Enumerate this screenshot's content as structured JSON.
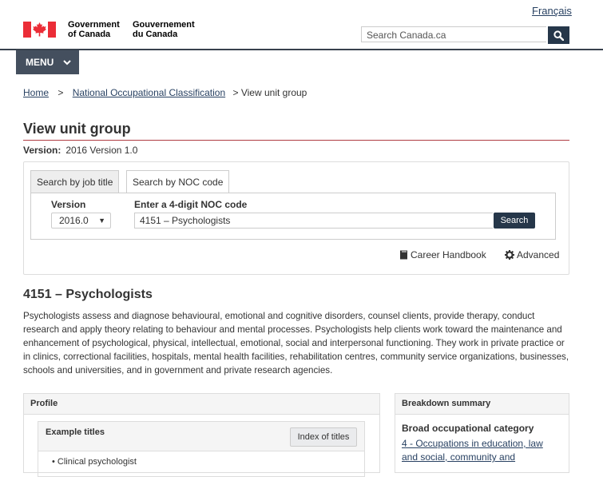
{
  "header": {
    "language_link": "Français",
    "signature_en_line1": "Government",
    "signature_en_line2": "of Canada",
    "signature_fr_line1": "Gouvernement",
    "signature_fr_line2": "du Canada",
    "search_placeholder": "Search Canada.ca",
    "menu_label": "MENU"
  },
  "breadcrumb": {
    "home": "Home",
    "separator": ">",
    "noc": "National Occupational Classification",
    "current": "> View unit group"
  },
  "page": {
    "title": "View unit group",
    "version_label": "Version:",
    "version_value": "2016 Version 1.0"
  },
  "search_panel": {
    "tabs": [
      "Search by job title",
      "Search by NOC code"
    ],
    "active_tab": 1,
    "version_label": "Version",
    "version_value": "2016.0",
    "noc_label": "Enter a 4-digit NOC code",
    "noc_value": "4151 – Psychologists",
    "search_button": "Search",
    "career_handbook": "Career Handbook",
    "advanced": "Advanced"
  },
  "unit_group": {
    "heading": "4151 – Psychologists",
    "description": "Psychologists assess and diagnose behavioural, emotional and cognitive disorders, counsel clients, provide therapy, conduct research and apply theory relating to behaviour and mental processes. Psychologists help clients work toward the maintenance and enhancement of psychological, physical, intellectual, emotional, social and interpersonal functioning. They work in private practice or in clinics, correctional facilities, hospitals, mental health facilities, rehabilitation centres, community service organizations, businesses, schools and universities, and in government and private research agencies."
  },
  "profile": {
    "heading": "Profile",
    "example_titles_heading": "Example titles",
    "index_button": "Index of titles",
    "example_titles": [
      "Clinical psychologist"
    ]
  },
  "breakdown": {
    "heading": "Breakdown summary",
    "broad_category_label": "Broad occupational category",
    "broad_category_link": "4 - Occupations in education, law and social, community and"
  },
  "colors": {
    "flag_red": "#eb2d37",
    "dark_blue": "#26374a",
    "link": "#284162",
    "title_rule": "#af3c43"
  }
}
